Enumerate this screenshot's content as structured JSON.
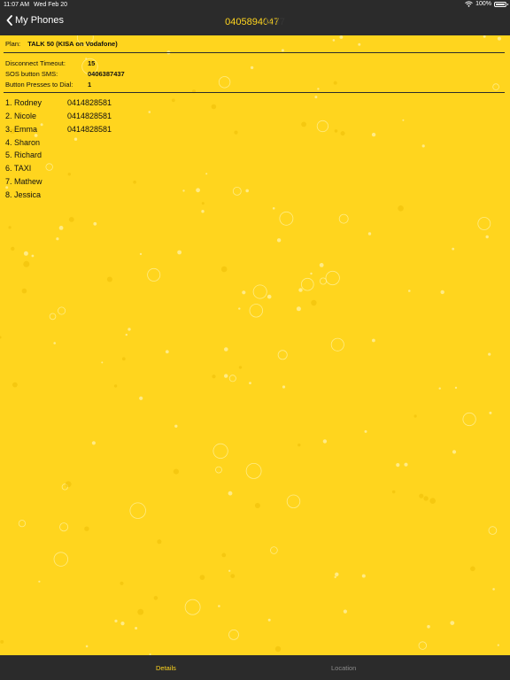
{
  "status_bar": {
    "time": "11:07 AM",
    "date": "Wed Feb 20",
    "battery_text": "100%",
    "icons": [
      "wifi-icon",
      "battery-icon"
    ]
  },
  "nav": {
    "back_label": "My Phones",
    "title": "0405894047",
    "title_ghost": "4047",
    "back_icon": "chevron-left-icon"
  },
  "plan": {
    "label": "Plan:",
    "value": "TALK 50 (KISA on Vodafone)"
  },
  "settings": [
    {
      "label": "Disconnect Timeout:",
      "value": "15"
    },
    {
      "label": "SOS button SMS:",
      "value": "0406387437"
    },
    {
      "label": "Button Presses to Dial:",
      "value": "1"
    }
  ],
  "contacts": [
    {
      "index": "1.",
      "name": "Rodney",
      "number": "0414828581"
    },
    {
      "index": "2.",
      "name": "Nicole",
      "number": "0414828581"
    },
    {
      "index": "3.",
      "name": "Emma",
      "number": "0414828581"
    },
    {
      "index": "4.",
      "name": "Sharon",
      "number": ""
    },
    {
      "index": "5.",
      "name": "Richard",
      "number": ""
    },
    {
      "index": "6.",
      "name": "TAXI",
      "number": ""
    },
    {
      "index": "7.",
      "name": "Mathew",
      "number": ""
    },
    {
      "index": "8.",
      "name": "Jessica",
      "number": ""
    }
  ],
  "tabs": [
    {
      "label": "Details",
      "active": true
    },
    {
      "label": "Location",
      "active": false
    }
  ],
  "colors": {
    "accent": "#ffd51e",
    "bar": "#2b2b2b",
    "inactive_tab": "#8a8a8a"
  }
}
